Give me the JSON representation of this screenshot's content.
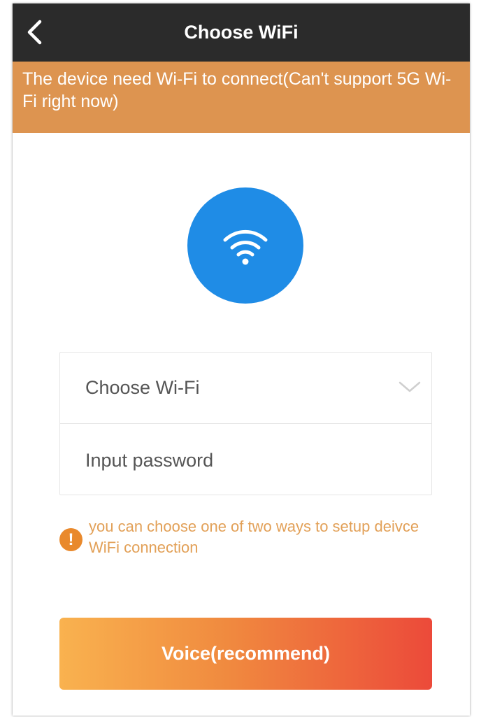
{
  "navbar": {
    "title": "Choose WiFi",
    "back_icon": "chevron-left-icon"
  },
  "banner": {
    "text": "The device need Wi-Fi to connect(Can't support 5G Wi-Fi right now)"
  },
  "wifi_illustration": {
    "icon": "wifi-icon",
    "color": "#1f8ce6"
  },
  "form": {
    "wifi_select": {
      "placeholder": "Choose Wi-Fi",
      "icon": "chevron-down-icon"
    },
    "password": {
      "placeholder": "Input password"
    }
  },
  "notice": {
    "icon": "exclamation-icon",
    "text": "you can choose one of two ways to setup deivce WiFi connection"
  },
  "actions": {
    "voice_label": "Voice(recommend)"
  },
  "colors": {
    "navbar": "#2b2b2b",
    "banner": "#dd9450",
    "notice_text": "#e2a057",
    "button_gradient_start": "#f9b24f",
    "button_gradient_end": "#ec4a3a"
  }
}
